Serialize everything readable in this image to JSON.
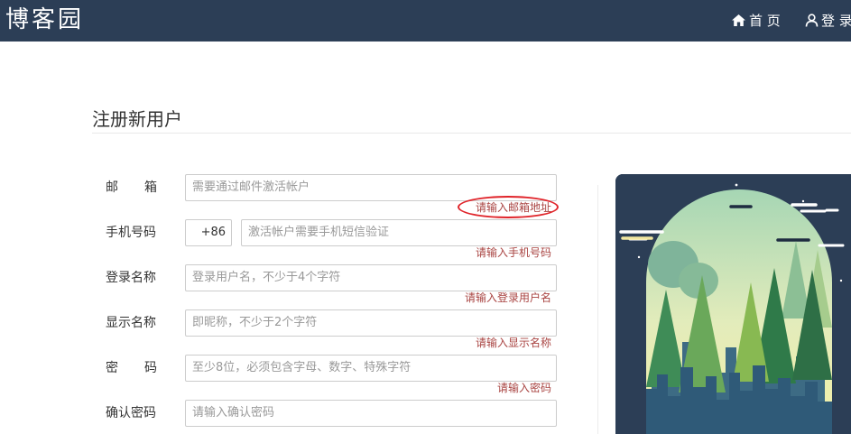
{
  "header": {
    "logo": "博客园",
    "nav_home": "首 页",
    "nav_login": "登 录"
  },
  "page": {
    "title": "注册新用户"
  },
  "form": {
    "email": {
      "label_chars": [
        "邮",
        "箱"
      ],
      "placeholder": "需要通过邮件激活帐户",
      "error": "请输入邮箱地址"
    },
    "phone": {
      "label": "手机号码",
      "prefix": "+86",
      "placeholder": "激活帐户需要手机短信验证",
      "error": "请输入手机号码"
    },
    "login_name": {
      "label": "登录名称",
      "placeholder": "登录用户名，不少于4个字符",
      "error": "请输入登录用户名"
    },
    "display_name": {
      "label": "显示名称",
      "placeholder": "即昵称，不少于2个字符",
      "error": "请输入显示名称"
    },
    "password": {
      "label_chars": [
        "密",
        "码"
      ],
      "placeholder": "至少8位，必须包含字母、数字、特殊字符",
      "error": "请输入密码"
    },
    "confirm_password": {
      "label": "确认密码",
      "placeholder": "请输入确认密码"
    }
  },
  "colors": {
    "header_bg": "#2c3e56",
    "error_text": "#a94442",
    "highlight_ring": "#e0242a"
  },
  "icons": {
    "home": "home-icon",
    "user": "user-icon"
  }
}
